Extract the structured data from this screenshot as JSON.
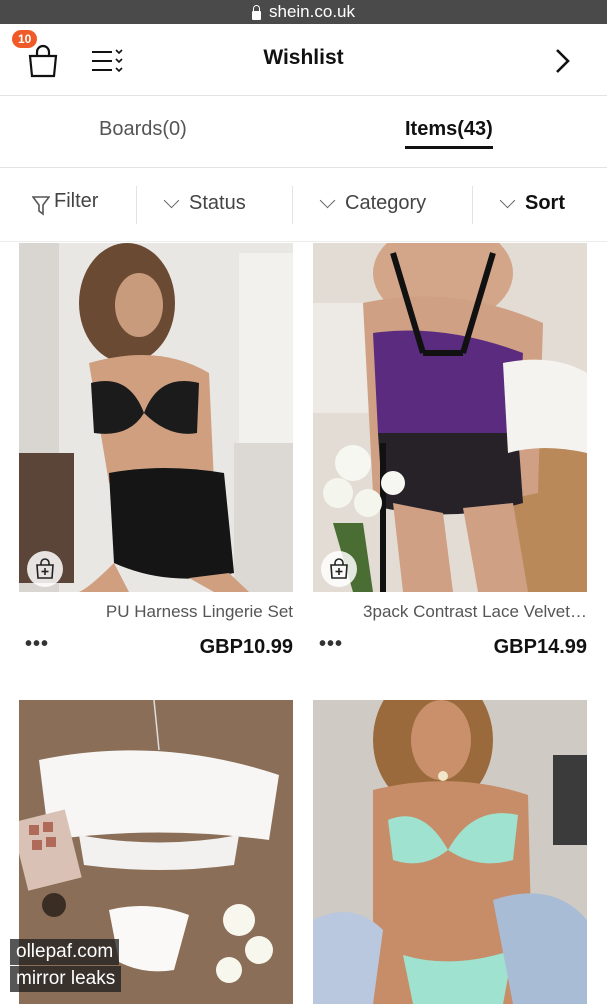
{
  "browser": {
    "url": "shein.co.uk"
  },
  "header": {
    "title": "Wishlist",
    "cart_count": "10"
  },
  "tabs": [
    {
      "label": "Items(43)",
      "active": true
    },
    {
      "label": "Boards(0)",
      "active": false
    }
  ],
  "filters": {
    "sort": "Sort",
    "category": "Category",
    "status": "Status",
    "filter": "Filter"
  },
  "products": [
    {
      "name": "3pack Contrast Lace Velvet…",
      "price": "GBP14.99",
      "more": "•••"
    },
    {
      "name": "PU Harness Lingerie Set",
      "price": "GBP10.99",
      "more": "•••"
    },
    {
      "name": "",
      "price": "",
      "more": ""
    },
    {
      "name": "",
      "price": "",
      "more": ""
    }
  ],
  "watermark": {
    "line1": "ollepaf.com",
    "line2": "mirror leaks"
  },
  "colors": {
    "badge": "#f05a28",
    "urlbar": "#4a4a4a",
    "text": "#111111"
  }
}
